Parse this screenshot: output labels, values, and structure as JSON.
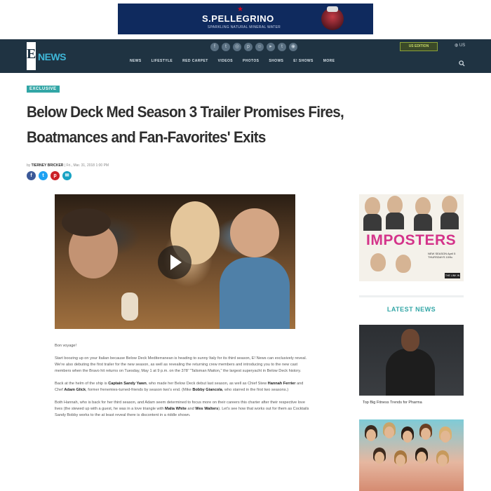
{
  "ad_banner": {
    "brand": "S.PELLEGRINO",
    "tagline": "SPARKLING NATURAL MINERAL WATER"
  },
  "nav": {
    "logo_letter": "E",
    "logo_word": "NEWS",
    "links": [
      "NEWS",
      "LIFESTYLE",
      "RED CARPET",
      "VIDEOS",
      "PHOTOS",
      "SHOWS",
      "E! SHOWS",
      "MORE"
    ],
    "edition_button": "US EDITION",
    "region": "US",
    "social_icons": [
      "facebook-icon",
      "twitter-icon",
      "instagram-icon",
      "pinterest-icon",
      "snapchat-icon",
      "youtube-icon",
      "tumblr-icon",
      "rss-icon"
    ]
  },
  "article": {
    "tag": "EXCLUSIVE",
    "title": "Below Deck Med Season 3 Trailer Promises Fires, Boatmances and Fan-Favorites' Exits",
    "byline_prefix": "by",
    "author": "TIERNEY BRICKER",
    "date": "| Fri., Mar. 31, 2018 1:00 PM"
  },
  "share": [
    "facebook",
    "twitter",
    "pinterest",
    "email"
  ],
  "body": {
    "p1": "Bon voyage!",
    "p2": "Start boozing up on your Italian because Below Deck Mediterranean is heading to sunny Italy for its third season, E! News can exclusively reveal. We're also debuting the first trailer for the new season, as well as revealing the returning crew members and introducing you to the new cast members when the Bravo hit returns on Tuesday, May 1 at 9 p.m. on the 378' \"Talisman Maiton,\" the largest superyacht in Below Deck history.",
    "p3a": "Back at the helm of the ship is ",
    "p3b": "Captain Sandy Yawn",
    "p3c": ", who made her Below Deck debut last season, as well as Chief Stew ",
    "p3d": "Hannah Ferrier",
    "p3e": " and Chef ",
    "p3f": "Adam Glick",
    "p3g": ", former frenemies-turned-friends by season two's end. (Mike ",
    "p3h": "Bobby Giancola",
    "p3i": ", who starred in the first two seasons.)",
    "p4a": "Both Hannah, who is back for her third season, and Adam seem determined to focus more on their careers this charter after their respective love lives (the stewed up with a guest, he was in a love triangle with ",
    "p4b": "Malia White",
    "p4c": " and ",
    "p4d": "Wes Walters",
    "p4e": "). Let's see how that works out for them as Cocktails Sandy Bobby works to the at least reveal there is discontent in a riddle shown."
  },
  "sidebar": {
    "ad_title": "IMPOSTERS",
    "ad_info": "NEW SEASON April 5 THURSDAYS 10/9c",
    "ad_network": "THE LINK IN",
    "latest_heading": "LATEST NEWS",
    "latest_caption_1": "Top Big Fitness Trends for Pharma"
  }
}
